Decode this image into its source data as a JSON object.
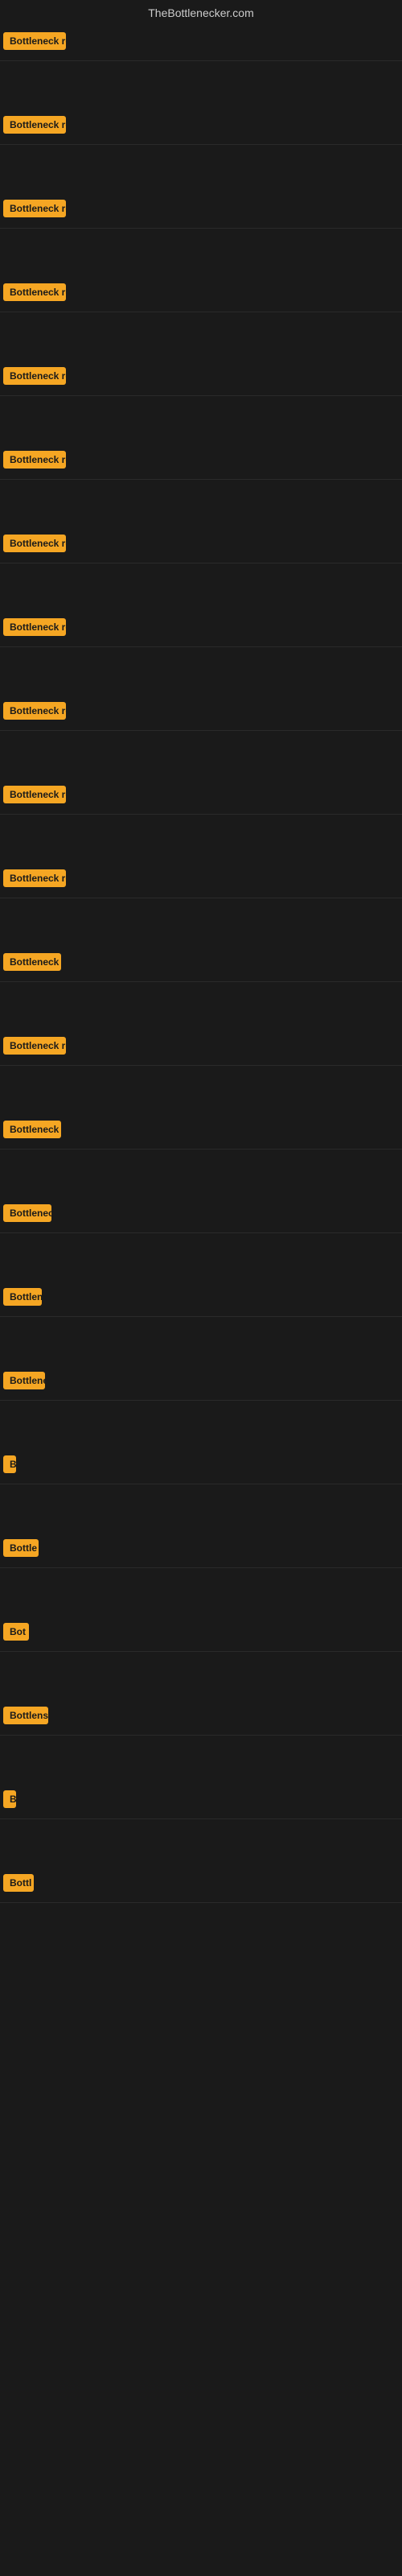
{
  "site": {
    "title": "TheBottlenecker.com"
  },
  "badge_text": "Bottleneck result",
  "rows": [
    {
      "id": 1,
      "label": "Bottleneck result"
    },
    {
      "id": 2,
      "label": "Bottleneck result"
    },
    {
      "id": 3,
      "label": "Bottleneck result"
    },
    {
      "id": 4,
      "label": "Bottleneck result"
    },
    {
      "id": 5,
      "label": "Bottleneck result"
    },
    {
      "id": 6,
      "label": "Bottleneck result"
    },
    {
      "id": 7,
      "label": "Bottleneck result"
    },
    {
      "id": 8,
      "label": "Bottleneck result"
    },
    {
      "id": 9,
      "label": "Bottleneck result"
    },
    {
      "id": 10,
      "label": "Bottleneck result"
    },
    {
      "id": 11,
      "label": "Bottleneck result"
    },
    {
      "id": 12,
      "label": "Bottleneck resu"
    },
    {
      "id": 13,
      "label": "Bottleneck result"
    },
    {
      "id": 14,
      "label": "Bottleneck resu"
    },
    {
      "id": 15,
      "label": "Bottleneck r"
    },
    {
      "id": 16,
      "label": "Bottlen"
    },
    {
      "id": 17,
      "label": "Bottleneck"
    },
    {
      "id": 18,
      "label": "B"
    },
    {
      "id": 19,
      "label": "Bottle"
    },
    {
      "id": 20,
      "label": "Bot"
    },
    {
      "id": 21,
      "label": "Bottlens"
    },
    {
      "id": 22,
      "label": "B"
    },
    {
      "id": 23,
      "label": "Bottl"
    }
  ]
}
